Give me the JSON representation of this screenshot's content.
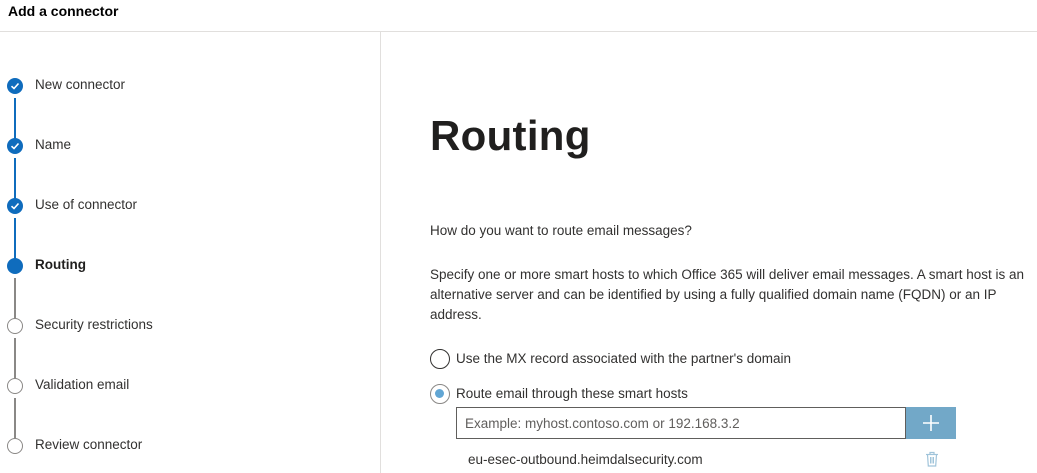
{
  "header": {
    "title": "Add a connector"
  },
  "steps": [
    {
      "label": "New connector",
      "status": "done"
    },
    {
      "label": "Name",
      "status": "done"
    },
    {
      "label": "Use of connector",
      "status": "done"
    },
    {
      "label": "Routing",
      "status": "current"
    },
    {
      "label": "Security restrictions",
      "status": "pending"
    },
    {
      "label": "Validation email",
      "status": "pending"
    },
    {
      "label": "Review connector",
      "status": "pending"
    }
  ],
  "main": {
    "title": "Routing",
    "question": "How do you want to route email messages?",
    "description": "Specify one or more smart hosts to which Office 365 will deliver email messages. A smart host is an alternative server and can be identified by using a fully qualified domain name (FQDN) or an IP address.",
    "options": [
      {
        "label": "Use the MX record associated with the partner's domain",
        "selected": false
      },
      {
        "label": "Route email through these smart hosts",
        "selected": true
      }
    ],
    "host_input": {
      "value": "",
      "placeholder": "Example: myhost.contoso.com or 192.168.3.2"
    },
    "add_button_icon": "plus-icon",
    "hosts": [
      "eu-esec-outbound.heimdalsecurity.com"
    ],
    "delete_icon": "trash-icon"
  },
  "colors": {
    "accent": "#0f6cbd",
    "add_button": "#72a8c8",
    "radio_selected": "#62a6d4",
    "pending_line": "#8a8886"
  }
}
